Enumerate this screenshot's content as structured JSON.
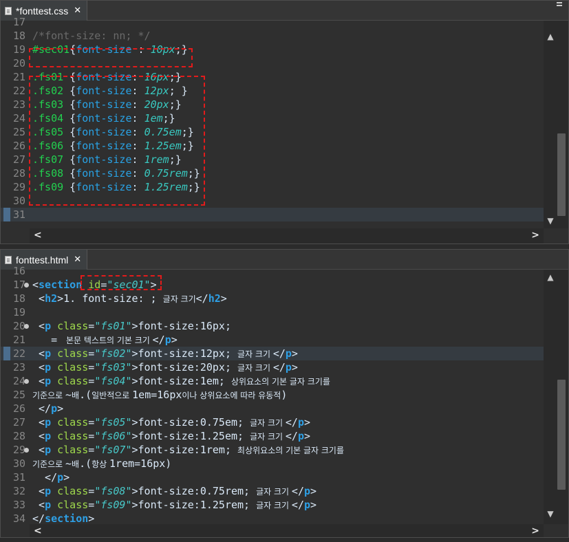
{
  "css_editor": {
    "tab_title": "*fonttest.css",
    "tab_close": "✕",
    "lines": [
      {
        "n": "17",
        "frag": []
      },
      {
        "n": "18",
        "frag": [
          [
            "cmt",
            "/*font-size: nn; */"
          ]
        ]
      },
      {
        "n": "19",
        "frag": [
          [
            "sel",
            "#sec01"
          ],
          [
            "txt",
            "{"
          ],
          [
            "prop",
            "font-size"
          ],
          [
            "txt",
            " : "
          ],
          [
            "val",
            "10px"
          ],
          [
            "txt",
            ";}"
          ]
        ]
      },
      {
        "n": "20",
        "frag": []
      },
      {
        "n": "21",
        "frag": [
          [
            "sel",
            ".fs01"
          ],
          [
            "txt",
            " {"
          ],
          [
            "prop",
            "font-size"
          ],
          [
            "txt",
            ": "
          ],
          [
            "val",
            "16px"
          ],
          [
            "txt",
            ";}"
          ]
        ]
      },
      {
        "n": "22",
        "frag": [
          [
            "sel",
            ".fs02"
          ],
          [
            "txt",
            " {"
          ],
          [
            "prop",
            "font-size"
          ],
          [
            "txt",
            ": "
          ],
          [
            "val",
            "12px"
          ],
          [
            "txt",
            "; }"
          ]
        ]
      },
      {
        "n": "23",
        "frag": [
          [
            "sel",
            ".fs03"
          ],
          [
            "txt",
            " {"
          ],
          [
            "prop",
            "font-size"
          ],
          [
            "txt",
            ": "
          ],
          [
            "val",
            "20px"
          ],
          [
            "txt",
            ";}"
          ]
        ]
      },
      {
        "n": "24",
        "frag": [
          [
            "sel",
            ".fs04"
          ],
          [
            "txt",
            " {"
          ],
          [
            "prop",
            "font-size"
          ],
          [
            "txt",
            ": "
          ],
          [
            "val",
            "1em"
          ],
          [
            "txt",
            ";}"
          ]
        ]
      },
      {
        "n": "25",
        "frag": [
          [
            "sel",
            ".fs05"
          ],
          [
            "txt",
            " {"
          ],
          [
            "prop",
            "font-size"
          ],
          [
            "txt",
            ": "
          ],
          [
            "val",
            "0.75em"
          ],
          [
            "txt",
            ";}"
          ]
        ]
      },
      {
        "n": "26",
        "frag": [
          [
            "sel",
            ".fs06"
          ],
          [
            "txt",
            " {"
          ],
          [
            "prop",
            "font-size"
          ],
          [
            "txt",
            ": "
          ],
          [
            "val",
            "1.25em"
          ],
          [
            "txt",
            ";}"
          ]
        ]
      },
      {
        "n": "27",
        "frag": [
          [
            "sel",
            ".fs07"
          ],
          [
            "txt",
            " {"
          ],
          [
            "prop",
            "font-size"
          ],
          [
            "txt",
            ": "
          ],
          [
            "val",
            "1rem"
          ],
          [
            "txt",
            ";}"
          ]
        ]
      },
      {
        "n": "28",
        "frag": [
          [
            "sel",
            ".fs08"
          ],
          [
            "txt",
            " {"
          ],
          [
            "prop",
            "font-size"
          ],
          [
            "txt",
            ": "
          ],
          [
            "val",
            "0.75rem"
          ],
          [
            "txt",
            ";}"
          ]
        ]
      },
      {
        "n": "29",
        "frag": [
          [
            "sel",
            ".fs09"
          ],
          [
            "txt",
            " {"
          ],
          [
            "prop",
            "font-size"
          ],
          [
            "txt",
            ": "
          ],
          [
            "val",
            "1.25rem"
          ],
          [
            "txt",
            ";}"
          ]
        ]
      },
      {
        "n": "30",
        "frag": []
      },
      {
        "n": "31",
        "frag": []
      }
    ]
  },
  "html_editor": {
    "tab_title": "fonttest.html",
    "tab_close": "✕",
    "lines": [
      {
        "n": "16",
        "frag": []
      },
      {
        "n": "17",
        "frag": [
          [
            "txt",
            "<"
          ],
          [
            "tag",
            "section"
          ],
          [
            "txt",
            " "
          ],
          [
            "attr",
            "id"
          ],
          [
            "txt",
            "="
          ],
          [
            "str",
            "\"sec01\""
          ],
          [
            "txt",
            ">"
          ]
        ]
      },
      {
        "n": "18",
        "frag": [
          [
            "txt",
            " <"
          ],
          [
            "tag",
            "h2"
          ],
          [
            "txt",
            ">1. font-size: ; "
          ],
          [
            "ko",
            "글자 크기"
          ],
          [
            "txt",
            "</"
          ],
          [
            "tag",
            "h2"
          ],
          [
            "txt",
            ">"
          ]
        ]
      },
      {
        "n": "19",
        "frag": []
      },
      {
        "n": "20",
        "frag": [
          [
            "txt",
            " <"
          ],
          [
            "tag",
            "p"
          ],
          [
            "txt",
            " "
          ],
          [
            "attr",
            "class"
          ],
          [
            "txt",
            "="
          ],
          [
            "str",
            "\"fs01\""
          ],
          [
            "txt",
            ">font-size:16px;"
          ]
        ]
      },
      {
        "n": "21",
        "frag": [
          [
            "txt",
            "   = "
          ],
          [
            "ko",
            " 본문 텍스트의 기본 크기 "
          ],
          [
            "txt",
            "</"
          ],
          [
            "tag",
            "p"
          ],
          [
            "txt",
            ">"
          ]
        ]
      },
      {
        "n": "22",
        "frag": [
          [
            "txt",
            " <"
          ],
          [
            "tag",
            "p"
          ],
          [
            "txt",
            " "
          ],
          [
            "attr",
            "class"
          ],
          [
            "txt",
            "="
          ],
          [
            "str",
            "\"fs02\""
          ],
          [
            "txt",
            ">font-size:12px; "
          ],
          [
            "ko",
            "글자 크기 "
          ],
          [
            "txt",
            "</"
          ],
          [
            "tag",
            "p"
          ],
          [
            "txt",
            ">"
          ]
        ]
      },
      {
        "n": "23",
        "frag": [
          [
            "txt",
            " <"
          ],
          [
            "tag",
            "p"
          ],
          [
            "txt",
            " "
          ],
          [
            "attr",
            "class"
          ],
          [
            "txt",
            "="
          ],
          [
            "str",
            "\"fs03\""
          ],
          [
            "txt",
            ">font-size:20px; "
          ],
          [
            "ko",
            "글자 크기 "
          ],
          [
            "txt",
            "</"
          ],
          [
            "tag",
            "p"
          ],
          [
            "txt",
            ">"
          ]
        ]
      },
      {
        "n": "24",
        "frag": [
          [
            "txt",
            " <"
          ],
          [
            "tag",
            "p"
          ],
          [
            "txt",
            " "
          ],
          [
            "attr",
            "class"
          ],
          [
            "txt",
            "="
          ],
          [
            "str",
            "\"fs04\""
          ],
          [
            "txt",
            ">font-size:1em; "
          ],
          [
            "ko",
            "상위요소의 기본 글자 크기를"
          ]
        ]
      },
      {
        "n": "25",
        "frag": [
          [
            "ko",
            "기준으로 "
          ],
          [
            "txt",
            "~"
          ],
          [
            "ko",
            "배"
          ],
          [
            "txt",
            ".("
          ],
          [
            "ko",
            "일반적으로 "
          ],
          [
            "txt",
            "1em=16px"
          ],
          [
            "ko",
            "이나 상위요소에 따라 유동적"
          ],
          [
            "txt",
            ")"
          ]
        ]
      },
      {
        "n": "26",
        "frag": [
          [
            "txt",
            " </"
          ],
          [
            "tag",
            "p"
          ],
          [
            "txt",
            ">"
          ]
        ]
      },
      {
        "n": "27",
        "frag": [
          [
            "txt",
            " <"
          ],
          [
            "tag",
            "p"
          ],
          [
            "txt",
            " "
          ],
          [
            "attr",
            "class"
          ],
          [
            "txt",
            "="
          ],
          [
            "str",
            "\"fs05\""
          ],
          [
            "txt",
            ">font-size:0.75em; "
          ],
          [
            "ko",
            "글자 크기 "
          ],
          [
            "txt",
            "</"
          ],
          [
            "tag",
            "p"
          ],
          [
            "txt",
            ">"
          ]
        ]
      },
      {
        "n": "28",
        "frag": [
          [
            "txt",
            " <"
          ],
          [
            "tag",
            "p"
          ],
          [
            "txt",
            " "
          ],
          [
            "attr",
            "class"
          ],
          [
            "txt",
            "="
          ],
          [
            "str",
            "\"fs06\""
          ],
          [
            "txt",
            ">font-size:1.25em; "
          ],
          [
            "ko",
            "글자 크기 "
          ],
          [
            "txt",
            "</"
          ],
          [
            "tag",
            "p"
          ],
          [
            "txt",
            ">"
          ]
        ]
      },
      {
        "n": "29",
        "frag": [
          [
            "txt",
            " <"
          ],
          [
            "tag",
            "p"
          ],
          [
            "txt",
            " "
          ],
          [
            "attr",
            "class"
          ],
          [
            "txt",
            "="
          ],
          [
            "str",
            "\"fs07\""
          ],
          [
            "txt",
            ">font-size:1rem; "
          ],
          [
            "ko",
            "최상위요소의 기본 글자 크기를"
          ]
        ]
      },
      {
        "n": "30",
        "frag": [
          [
            "ko",
            "기준으로 "
          ],
          [
            "txt",
            "~"
          ],
          [
            "ko",
            "배"
          ],
          [
            "txt",
            ".("
          ],
          [
            "ko",
            "항상 "
          ],
          [
            "txt",
            "1rem=16px)"
          ]
        ]
      },
      {
        "n": "31",
        "frag": [
          [
            "txt",
            "  </"
          ],
          [
            "tag",
            "p"
          ],
          [
            "txt",
            ">"
          ]
        ]
      },
      {
        "n": "32",
        "frag": [
          [
            "txt",
            " <"
          ],
          [
            "tag",
            "p"
          ],
          [
            "txt",
            " "
          ],
          [
            "attr",
            "class"
          ],
          [
            "txt",
            "="
          ],
          [
            "str",
            "\"fs08\""
          ],
          [
            "txt",
            ">font-size:0.75rem; "
          ],
          [
            "ko",
            "글자 크기 "
          ],
          [
            "txt",
            "</"
          ],
          [
            "tag",
            "p"
          ],
          [
            "txt",
            ">"
          ]
        ]
      },
      {
        "n": "33",
        "frag": [
          [
            "txt",
            " <"
          ],
          [
            "tag",
            "p"
          ],
          [
            "txt",
            " "
          ],
          [
            "attr",
            "class"
          ],
          [
            "txt",
            "="
          ],
          [
            "str",
            "\"fs09\""
          ],
          [
            "txt",
            ">font-size:1.25rem; "
          ],
          [
            "ko",
            "글자 크기 "
          ],
          [
            "txt",
            "</"
          ],
          [
            "tag",
            "p"
          ],
          [
            "txt",
            ">"
          ]
        ]
      },
      {
        "n": "34",
        "frag": [
          [
            "txt",
            "</"
          ],
          [
            "tag",
            "section"
          ],
          [
            "txt",
            ">"
          ]
        ]
      }
    ]
  },
  "scroll_arrows": {
    "up": "▲",
    "down": "▼",
    "left": "<",
    "right": ">"
  },
  "colors": {
    "selector": "#22d14f",
    "property": "#29a3e6",
    "value": "#39c9c0",
    "tag": "#2ea0e6",
    "attribute": "#9fd94c",
    "annotation": "#e31b1b"
  }
}
